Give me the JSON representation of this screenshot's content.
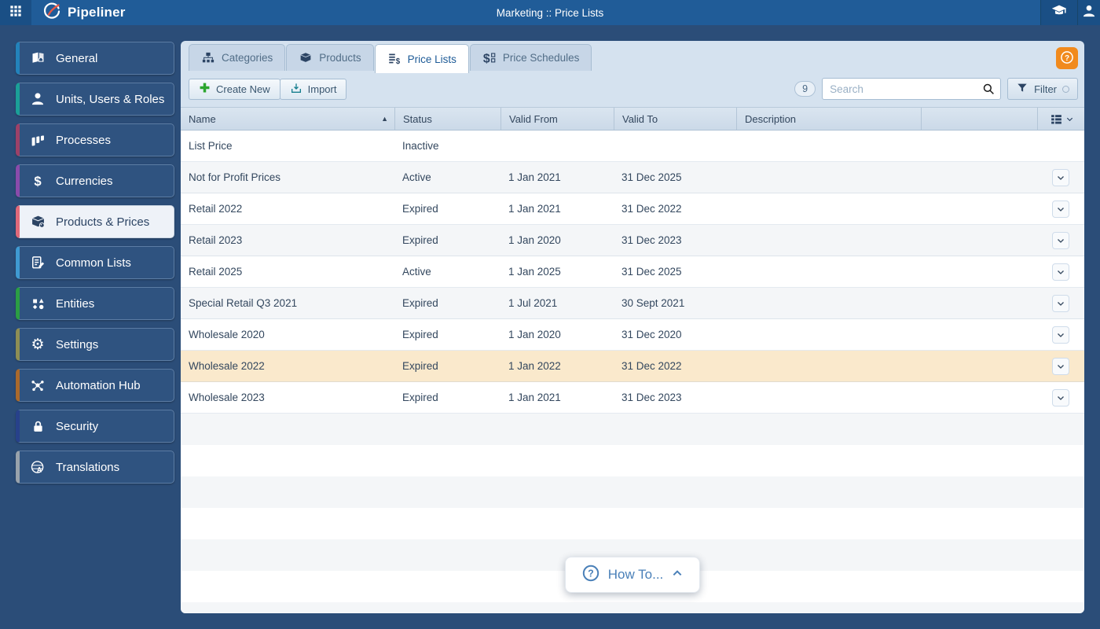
{
  "topbar": {
    "brand": "Pipeliner",
    "title": "Marketing :: Price Lists"
  },
  "sidebar": {
    "items": [
      {
        "label": "General",
        "accent": "#2383bb",
        "selected": false
      },
      {
        "label": "Units, Users & Roles",
        "accent": "#1ba098",
        "selected": false
      },
      {
        "label": "Processes",
        "accent": "#9c4168",
        "selected": false
      },
      {
        "label": "Currencies",
        "accent": "#8a4bab",
        "selected": false
      },
      {
        "label": "Products & Prices",
        "accent": "#e0697a",
        "selected": true
      },
      {
        "label": "Common Lists",
        "accent": "#3f9ad2",
        "selected": false
      },
      {
        "label": "Entities",
        "accent": "#2b9e44",
        "selected": false
      },
      {
        "label": "Settings",
        "accent": "#8e8e54",
        "selected": false
      },
      {
        "label": "Automation Hub",
        "accent": "#aa692c",
        "selected": false
      },
      {
        "label": "Security",
        "accent": "#27418b",
        "selected": false
      },
      {
        "label": "Translations",
        "accent": "#98a2ac",
        "selected": false
      }
    ]
  },
  "tabs": [
    {
      "label": "Categories",
      "active": false
    },
    {
      "label": "Products",
      "active": false
    },
    {
      "label": "Price Lists",
      "active": true
    },
    {
      "label": "Price Schedules",
      "active": false
    }
  ],
  "toolbar": {
    "create_label": "Create New",
    "import_label": "Import",
    "count_badge": "9",
    "search_placeholder": "Search",
    "filter_label": "Filter"
  },
  "table": {
    "columns": [
      "Name",
      "Status",
      "Valid From",
      "Valid To",
      "Description"
    ],
    "rows": [
      {
        "name": "List Price",
        "status": "Inactive",
        "valid_from": "",
        "valid_to": "",
        "description": "",
        "highlighted": false
      },
      {
        "name": "Not for Profit Prices",
        "status": "Active",
        "valid_from": "1 Jan 2021",
        "valid_to": "31 Dec 2025",
        "description": "",
        "highlighted": false
      },
      {
        "name": "Retail 2022",
        "status": "Expired",
        "valid_from": "1 Jan 2021",
        "valid_to": "31 Dec 2022",
        "description": "",
        "highlighted": false
      },
      {
        "name": "Retail 2023",
        "status": "Expired",
        "valid_from": "1 Jan 2020",
        "valid_to": "31 Dec 2023",
        "description": "",
        "highlighted": false
      },
      {
        "name": "Retail 2025",
        "status": "Active",
        "valid_from": "1 Jan 2025",
        "valid_to": "31 Dec 2025",
        "description": "",
        "highlighted": false
      },
      {
        "name": "Special Retail Q3 2021",
        "status": "Expired",
        "valid_from": "1 Jul 2021",
        "valid_to": "30 Sept 2021",
        "description": "",
        "highlighted": false
      },
      {
        "name": "Wholesale 2020",
        "status": "Expired",
        "valid_from": "1 Jan 2020",
        "valid_to": "31 Dec 2020",
        "description": "",
        "highlighted": false
      },
      {
        "name": "Wholesale 2022",
        "status": "Expired",
        "valid_from": "1 Jan 2022",
        "valid_to": "31 Dec 2022",
        "description": "",
        "highlighted": true
      },
      {
        "name": "Wholesale 2023",
        "status": "Expired",
        "valid_from": "1 Jan 2021",
        "valid_to": "31 Dec 2023",
        "description": "",
        "highlighted": false
      }
    ]
  },
  "howto": {
    "label": "How To..."
  },
  "colors": {
    "topbar": "#205c98",
    "background": "#2b4d78",
    "panel": "#d5e2ef",
    "help_orange": "#f18a1d",
    "highlight_row": "#fae9cc",
    "active_tab_text": "#1e5b97"
  }
}
